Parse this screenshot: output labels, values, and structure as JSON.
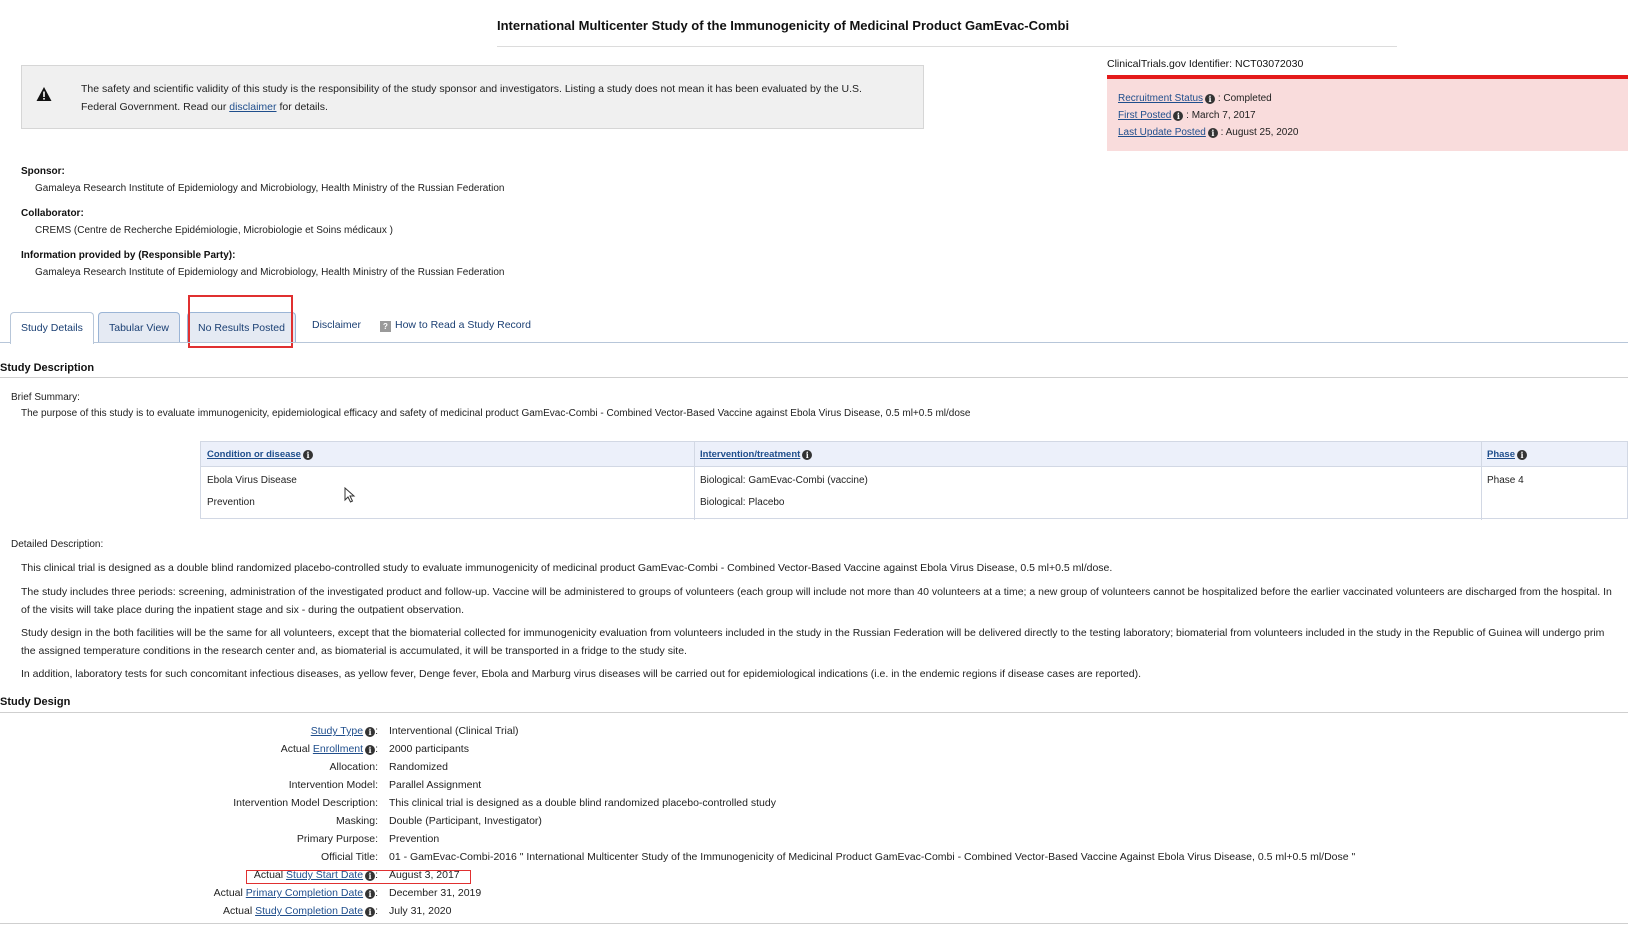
{
  "title": "International Multicenter Study of the Immunogenicity of Medicinal Product GamEvac-Combi",
  "disclaimer": {
    "text_line1": "The safety and scientific validity of this study is the responsibility of the study sponsor and investigators. Listing a study does not mean it has been evaluated by the U.S.",
    "text_line2_pre": "Federal Government. Read our",
    "link": "disclaimer",
    "text_line2_post": "for details."
  },
  "identifier": "ClinicalTrials.gov Identifier: NCT03072030",
  "status": {
    "recruitment_label": "Recruitment Status",
    "recruitment_value": ": Completed",
    "first_posted_label": "First Posted",
    "first_posted_value": ": March 7, 2017",
    "last_update_label": "Last Update Posted",
    "last_update_value": ": August 25, 2020"
  },
  "sponsor": {
    "label": "Sponsor:",
    "value": "Gamaleya Research Institute of Epidemiology and Microbiology, Health Ministry of the Russian Federation"
  },
  "collaborator": {
    "label": "Collaborator:",
    "value": "CREMS (Centre de Recherche Epidémiologie, Microbiologie et Soins médicaux )"
  },
  "responsible": {
    "label": "Information provided by (Responsible Party):",
    "value": "Gamaleya Research Institute of Epidemiology and Microbiology, Health Ministry of the Russian Federation"
  },
  "tabs": [
    {
      "label": "Study Details"
    },
    {
      "label": "Tabular View"
    },
    {
      "label": "No Results Posted"
    }
  ],
  "tab_links": {
    "disclaimer": "Disclaimer",
    "how_to": "How to Read a Study Record"
  },
  "study_description": {
    "heading": "Study Description",
    "brief_label": "Brief Summary:",
    "brief_text": "The purpose of this study is to evaluate immunogenicity, epidemiological efficacy and safety of medicinal product GamEvac-Combi - Combined Vector-Based Vaccine against Ebola Virus Disease, 0.5 ml+0.5 ml/dose",
    "table": {
      "headers": [
        "Condition or disease",
        "Intervention/treatment",
        "Phase"
      ],
      "conditions": [
        "Ebola Virus Disease",
        "Prevention"
      ],
      "interventions": [
        "Biological: GamEvac-Combi (vaccine)",
        "Biological: Placebo"
      ],
      "phase": "Phase 4"
    },
    "detailed_label": "Detailed Description:",
    "p1": "This clinical trial is designed as a double blind randomized placebo-controlled study to evaluate immunogenicity of medicinal product GamEvac-Combi - Combined Vector-Based Vaccine against Ebola Virus Disease, 0.5 ml+0.5 ml/dose.",
    "p2a": "The study includes three periods: screening, administration of the investigated product and follow-up. Vaccine will be administered to groups of volunteers (each group will include not more than 40 volunteers at a time; a new group of volunteers cannot be hospitalized before the earlier vaccinated volunteers are discharged from the hospital. In",
    "p2b": "of the visits will take place during the inpatient stage and six - during the outpatient observation.",
    "p3a": "Study design in the both facilities will be the same for all volunteers, except that the biomaterial collected for immunogenicity evaluation from volunteers included in the study in the Russian Federation will be delivered directly to the testing laboratory; biomaterial from volunteers included in the study in the Republic of Guinea will undergo prim",
    "p3b": "the assigned temperature conditions in the research center and, as biomaterial is accumulated, it will be transported in a fridge to the study site.",
    "p4": "In addition, laboratory tests for such concomitant infectious diseases, as yellow fever, Denge fever, Ebola and Marburg virus diseases will be carried out for epidemiological indications (i.e. in the endemic regions if disease cases are reported)."
  },
  "study_design": {
    "heading": "Study Design",
    "rows": [
      {
        "prefix": "",
        "link": "Study Type",
        "info": true,
        "value": "Interventional  (Clinical Trial)"
      },
      {
        "prefix": "Actual ",
        "link": "Enrollment",
        "info": true,
        "value": "2000 participants"
      },
      {
        "prefix": "Allocation:",
        "link": "",
        "info": false,
        "value": "Randomized"
      },
      {
        "prefix": "Intervention Model:",
        "link": "",
        "info": false,
        "value": "Parallel Assignment"
      },
      {
        "prefix": "Intervention Model Description:",
        "link": "",
        "info": false,
        "value": "This clinical trial is designed as a double blind randomized placebo-controlled study"
      },
      {
        "prefix": "Masking:",
        "link": "",
        "info": false,
        "value": "Double (Participant, Investigator)"
      },
      {
        "prefix": "Primary Purpose:",
        "link": "",
        "info": false,
        "value": "Prevention"
      },
      {
        "prefix": "Official Title:",
        "link": "",
        "info": false,
        "value": "01 - GamEvac-Combi-2016 \" International Multicenter Study of the Immunogenicity of Medicinal Product GamEvac-Combi - Combined Vector-Based Vaccine Against Ebola Virus Disease, 0.5 ml+0.5 ml/Dose \""
      },
      {
        "prefix": "Actual ",
        "link": "Study Start Date",
        "info": true,
        "value": "August 3, 2017"
      },
      {
        "prefix": "Actual ",
        "link": "Primary Completion Date",
        "info": true,
        "value": "December 31, 2019"
      },
      {
        "prefix": "Actual ",
        "link": "Study Completion Date",
        "info": true,
        "value": "July 31, 2020"
      }
    ]
  }
}
